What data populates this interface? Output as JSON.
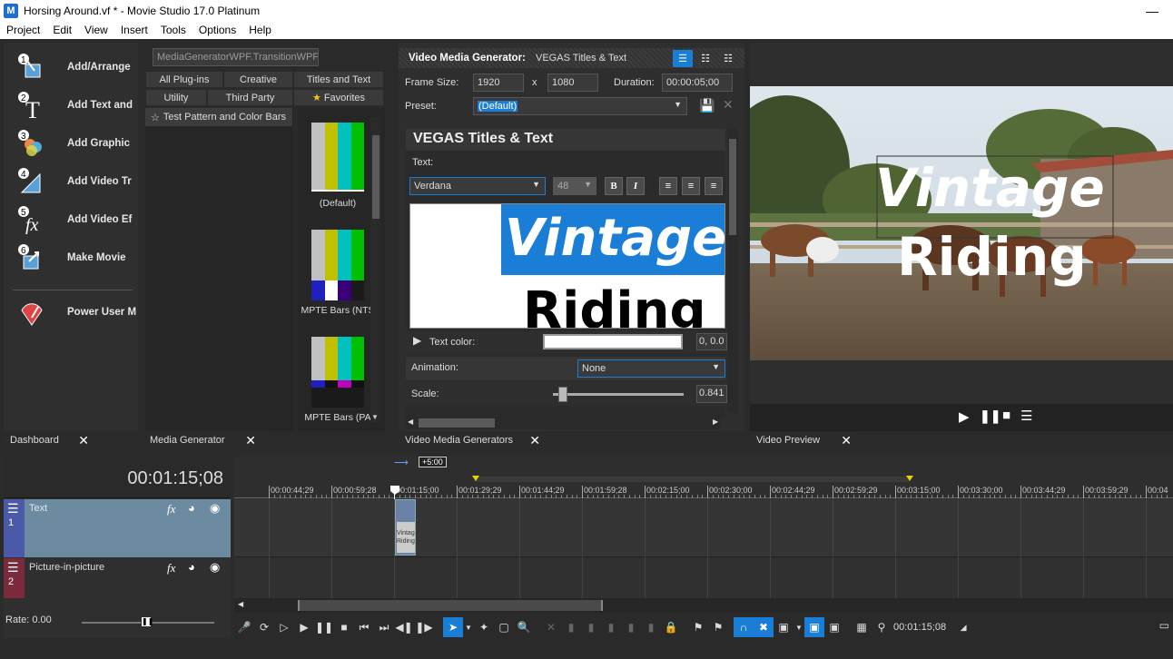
{
  "window": {
    "title": "Horsing Around.vf * - Movie Studio 17.0 Platinum",
    "app_icon_letter": "M"
  },
  "menu": [
    "Project",
    "Edit",
    "View",
    "Insert",
    "Tools",
    "Options",
    "Help"
  ],
  "dashboard": {
    "items": [
      {
        "num": "1",
        "label": "Add/Arrange",
        "icon": "add-arrange-icon"
      },
      {
        "num": "2",
        "label": "Add Text and",
        "icon": "text-icon"
      },
      {
        "num": "3",
        "label": "Add Graphic",
        "icon": "graphic-icon"
      },
      {
        "num": "4",
        "label": "Add Video Tr",
        "icon": "transition-icon"
      },
      {
        "num": "5",
        "label": "Add Video Ef",
        "icon": "fx-icon"
      },
      {
        "num": "6",
        "label": "Make Movie",
        "icon": "make-movie-icon"
      },
      {
        "num": "",
        "label": "Power User M",
        "icon": "power-user-icon"
      }
    ],
    "tab_label": "Dashboard"
  },
  "media_generator": {
    "search_value": "MediaGeneratorWPF.TransitionWPF",
    "tabs_row1": [
      "All Plug-ins",
      "Creative",
      "Titles and Text"
    ],
    "tabs_row2": [
      "Utility",
      "Third Party",
      "Favorites"
    ],
    "tree_item": "Test Pattern and Color Bars",
    "thumbs": [
      "(Default)",
      "MPTE Bars (NTS",
      "MPTE Bars (PA"
    ],
    "tab_label": "Media Generator"
  },
  "vmg": {
    "header_title": "Video Media Generator:",
    "header_value": "VEGAS Titles & Text",
    "frame_size_label": "Frame Size:",
    "frame_w": "1920",
    "x_label": "x",
    "frame_h": "1080",
    "duration_label": "Duration:",
    "duration": "00:00:05;00",
    "preset_label": "Preset:",
    "preset_value": "(Default)",
    "section_title": "VEGAS Titles & Text",
    "text_label": "Text:",
    "font": "Verdana",
    "size": "48",
    "bold": "B",
    "italic": "I",
    "preview_line1": "Vintage",
    "preview_line2": "Riding",
    "text_color_label": "Text color:",
    "text_color_value": "0, 0.0",
    "animation_label": "Animation:",
    "animation_value": "None",
    "scale_label": "Scale:",
    "scale_value": "0.841",
    "tab_label": "Video Media Generators"
  },
  "video_preview": {
    "line1": "Vintage",
    "line2": "Riding",
    "tab_label": "Video Preview"
  },
  "timeline": {
    "timecode": "00:01:15;08",
    "offset": "+5:00",
    "ruler": [
      "00:00:44;29",
      "00:00:59;28",
      "00:01:15;00",
      "00:01:29;29",
      "00:01:44;29",
      "00:01:59;28",
      "00:02:15;00",
      "00:02:30;00",
      "00:02:44;29",
      "00:02:59;29",
      "00:03:15;00",
      "00:03:30;00",
      "00:03:44;29",
      "00:03:59;29",
      "00:04"
    ],
    "tracks": [
      {
        "num": "1",
        "name": "Text"
      },
      {
        "num": "2",
        "name": "Picture-in-picture"
      }
    ],
    "rate": "Rate: 0.00",
    "cursor_time": "00:01:15;08",
    "clip_text": "Vintage Riding"
  }
}
